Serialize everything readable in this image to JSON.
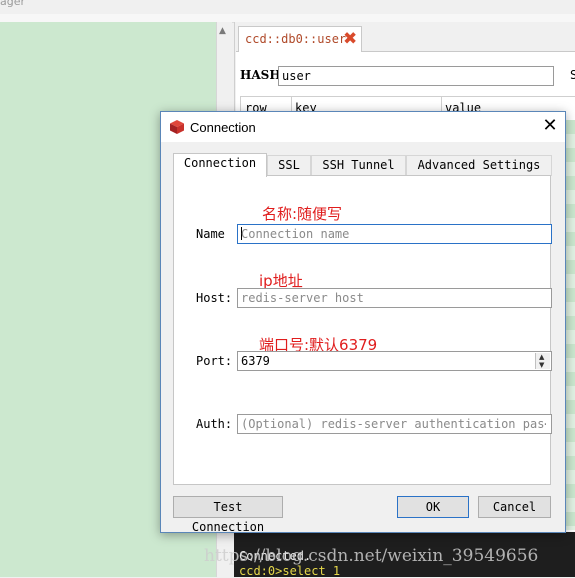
{
  "app": {
    "title_fragment": "ager"
  },
  "key_tab": {
    "label": "ccd::db0::user"
  },
  "key_view": {
    "type_label": "HASH:",
    "key_name": "user",
    "right_cut_label": "S",
    "columns": [
      "row",
      "key",
      "value"
    ]
  },
  "console": {
    "line1": "Connected.",
    "line2": "ccd:0>select 1"
  },
  "watermark": "https://blog.csdn.net/weixin_39549656",
  "dialog": {
    "title": "Connection",
    "tabs": [
      {
        "label": "Connection",
        "active": true
      },
      {
        "label": "SSL"
      },
      {
        "label": "SSH Tunnel"
      },
      {
        "label": "Advanced Settings"
      }
    ],
    "fields": {
      "name": {
        "label": "Name",
        "placeholder": "Connection name",
        "annotation": "名称:随便写"
      },
      "host": {
        "label": "Host:",
        "placeholder": "redis-server host",
        "annotation": "ip地址"
      },
      "port": {
        "label": "Port:",
        "value": "6379",
        "annotation": "端口号:默认6379"
      },
      "auth": {
        "label": "Auth:",
        "placeholder": "(Optional) redis-server authentication pas⋯"
      }
    },
    "buttons": {
      "test": "Test Connection",
      "ok": "OK",
      "cancel": "Cancel"
    }
  },
  "colors": {
    "tree_bg": "#cce8cf",
    "annotation": "#e01d1d",
    "tab_label": "#b04a2a",
    "focus_border": "#2a72c7",
    "console_text": "#e6d84a"
  },
  "icons": [
    "redis-logo-icon",
    "close-icon",
    "tab-close-icon",
    "spin-up-icon",
    "spin-down-icon",
    "scroll-up-icon"
  ]
}
